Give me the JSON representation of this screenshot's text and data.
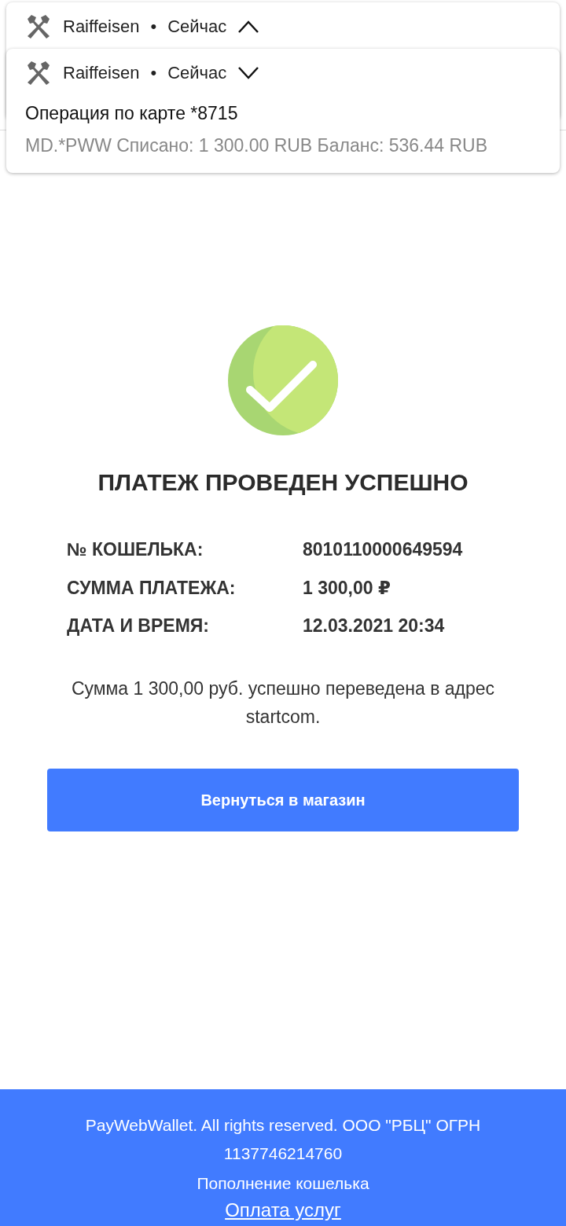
{
  "notifications": [
    {
      "app": "Raiffeisen",
      "separator": "•",
      "time": "Сейчас",
      "expanded": true
    },
    {
      "app": "Raiffeisen",
      "separator": "•",
      "time": "Сейчас",
      "expanded": false,
      "title": "Операция по карте *8715",
      "text": "MD.*PWW Списано: 1 300.00 RUB Баланс: 536.44 RUB"
    }
  ],
  "status": {
    "title": "ПЛАТЕЖ ПРОВЕДЕН УСПЕШНО"
  },
  "details": [
    {
      "label": "№ КОШЕЛЬКА:",
      "value": "8010110000649594"
    },
    {
      "label": "СУММА ПЛАТЕЖА:",
      "value": "1 300,00 ₽"
    },
    {
      "label": "ДАТА И ВРЕМЯ:",
      "value": "12.03.2021 20:34"
    }
  ],
  "message": "Сумма 1 300,00 руб. успешно переведена в адрес startcom.",
  "button": "Вернуться в магазин",
  "footer": {
    "copyright": "PayWebWallet. All rights reserved. ООО \"РБЦ\" ОГРН 1137746214760",
    "links": [
      {
        "label": "Пополнение кошелька",
        "underlined": false
      },
      {
        "label": "Оплата услуг",
        "underlined": true
      }
    ]
  }
}
